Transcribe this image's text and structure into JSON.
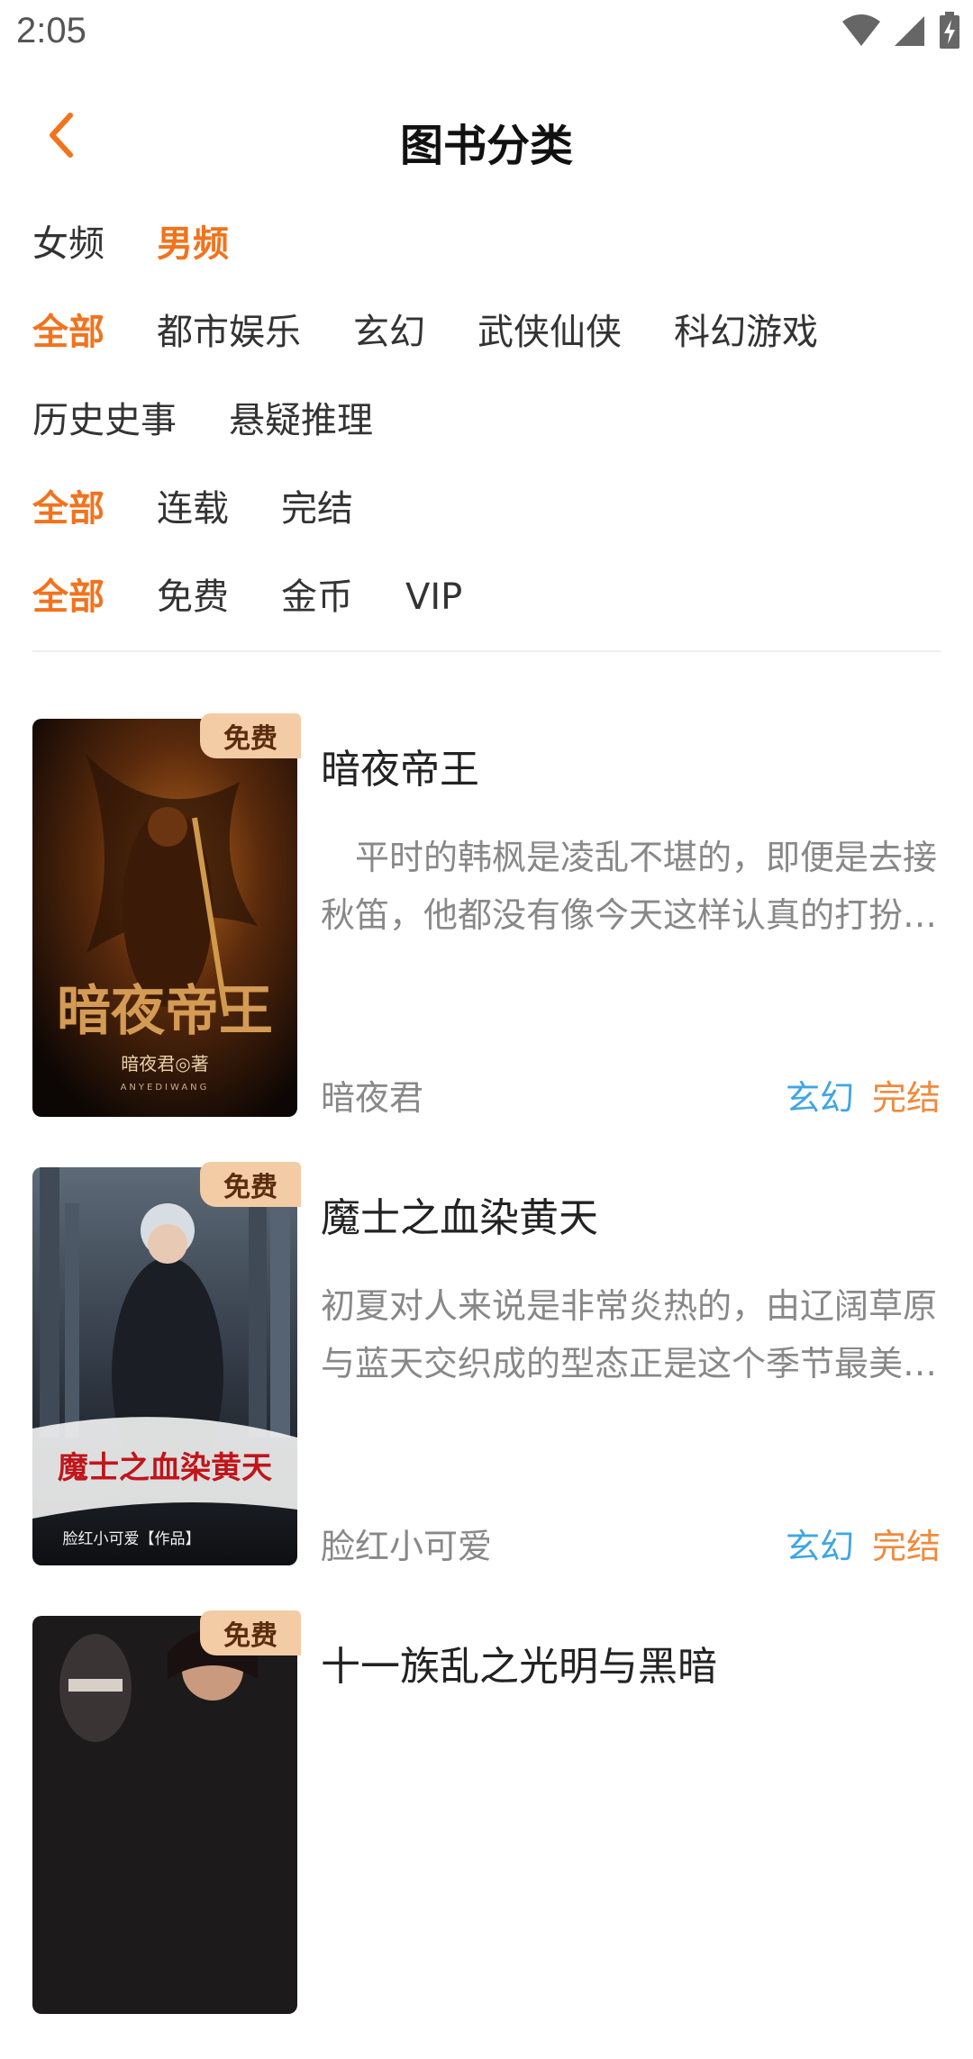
{
  "status_bar": {
    "time": "2:05"
  },
  "header": {
    "title": "图书分类"
  },
  "filters": {
    "gender": [
      {
        "label": "女频",
        "active": false
      },
      {
        "label": "男频",
        "active": true
      }
    ],
    "category": [
      {
        "label": "全部",
        "active": true
      },
      {
        "label": "都市娱乐",
        "active": false
      },
      {
        "label": "玄幻",
        "active": false
      },
      {
        "label": "武侠仙侠",
        "active": false
      },
      {
        "label": "科幻游戏",
        "active": false
      },
      {
        "label": "历史史事",
        "active": false
      },
      {
        "label": "悬疑推理",
        "active": false
      }
    ],
    "status": [
      {
        "label": "全部",
        "active": true
      },
      {
        "label": "连载",
        "active": false
      },
      {
        "label": "完结",
        "active": false
      }
    ],
    "price": [
      {
        "label": "全部",
        "active": true
      },
      {
        "label": "免费",
        "active": false
      },
      {
        "label": "金币",
        "active": false
      },
      {
        "label": "VIP",
        "active": false
      }
    ]
  },
  "books": [
    {
      "badge": "免费",
      "title": "暗夜帝王",
      "description": "　平时的韩枫是凌乱不堪的，即便是去接秋笛，他都没有像今天这样认真的打扮过。",
      "author": "暗夜君",
      "genre": "玄幻",
      "status": "完结",
      "cover_text": "暗夜帝王",
      "cover_author": "暗夜君◎著",
      "cover_sub": "ANYEDIWANG"
    },
    {
      "badge": "免费",
      "title": "魔士之血染黄天",
      "description": "初夏对人来说是非常炎热的，由辽阔草原与蓝天交织成的型态正是这个季节最美的风景。",
      "author": "脸红小可爱",
      "genre": "玄幻",
      "status": "完结",
      "cover_text": "魔士之血染黄天",
      "cover_author": "脸红小可爱【作品】"
    },
    {
      "badge": "免费",
      "title": "十一族乱之光明与黑暗"
    }
  ],
  "colors": {
    "accent": "#f2731d",
    "genre_tag": "#3fa6e3",
    "status_tag": "#f08a3c",
    "badge_bg": "#f3cba4"
  },
  "icons": {
    "back": "chevron-left-icon",
    "wifi": "wifi-icon",
    "signal": "signal-icon",
    "battery": "battery-icon"
  }
}
